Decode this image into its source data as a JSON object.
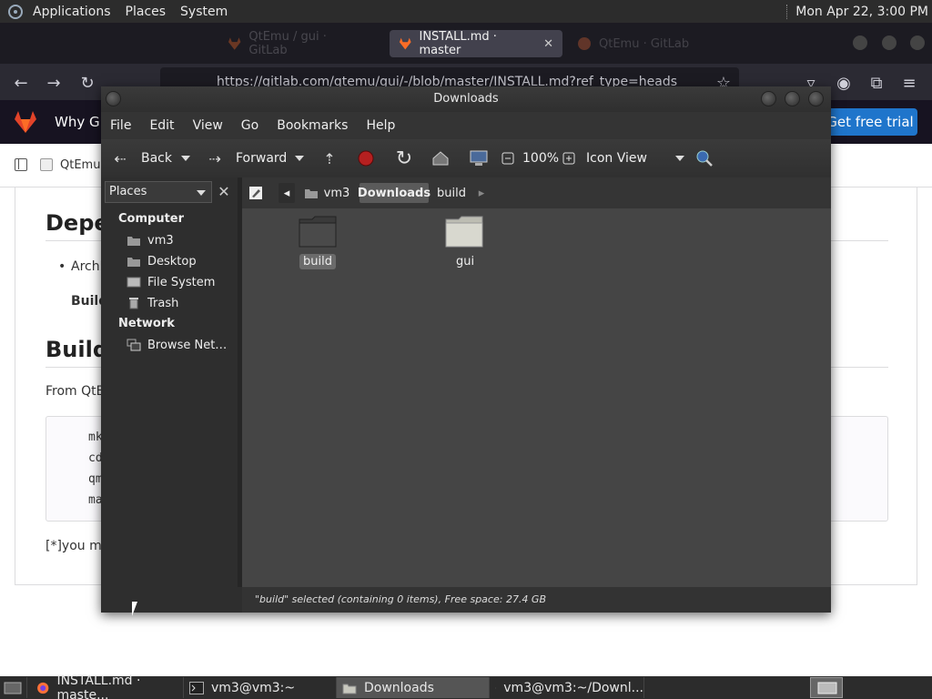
{
  "top_panel": {
    "applications": "Applications",
    "places": "Places",
    "system": "System",
    "clock": "Mon Apr 22,  3:00 PM"
  },
  "browser": {
    "tabs": [
      {
        "label": "QtEmu / gui · GitLab",
        "active": false
      },
      {
        "label": "INSTALL.md · master",
        "active": true
      },
      {
        "label": "QtEmu · GitLab",
        "active": false
      }
    ],
    "url": "https://gitlab.com/qtemu/gui/-/blob/master/INSTALL.md?ref_type=heads",
    "header": {
      "why": "Why GitLab",
      "trial": "Get free trial"
    },
    "breadcrumb": "QtEmu",
    "doc": {
      "h_dependencies": "Dependencies",
      "bullet": "Archlinux",
      "build_label": "Build",
      "h_build": "Build",
      "from_text": "From QtEmu",
      "code": [
        "mkdir build",
        "cd build",
        "qmake ..",
        "make"
      ],
      "footnote": "[*]you might"
    }
  },
  "fm": {
    "title": "Downloads",
    "menu": [
      "File",
      "Edit",
      "View",
      "Go",
      "Bookmarks",
      "Help"
    ],
    "toolbar": {
      "back": "Back",
      "forward": "Forward",
      "zoom": "100%",
      "view_mode": "Icon View"
    },
    "sidebar": {
      "select": "Places",
      "computer_heading": "Computer",
      "computer_items": [
        "vm3",
        "Desktop",
        "File System",
        "Trash"
      ],
      "network_heading": "Network",
      "network_items": [
        "Browse Net…"
      ]
    },
    "path": [
      "vm3",
      "Downloads",
      "build"
    ],
    "files": [
      {
        "name": "build",
        "selected": true
      },
      {
        "name": "gui",
        "selected": false
      }
    ],
    "status": "\"build\" selected (containing 0 items), Free space: 27.4 GB"
  },
  "taskbar": {
    "items": [
      {
        "label": "INSTALL.md · maste...",
        "active": false
      },
      {
        "label": "vm3@vm3:~",
        "active": false
      },
      {
        "label": "Downloads",
        "active": true
      },
      {
        "label": "vm3@vm3:~/Downl...",
        "active": false
      }
    ]
  }
}
